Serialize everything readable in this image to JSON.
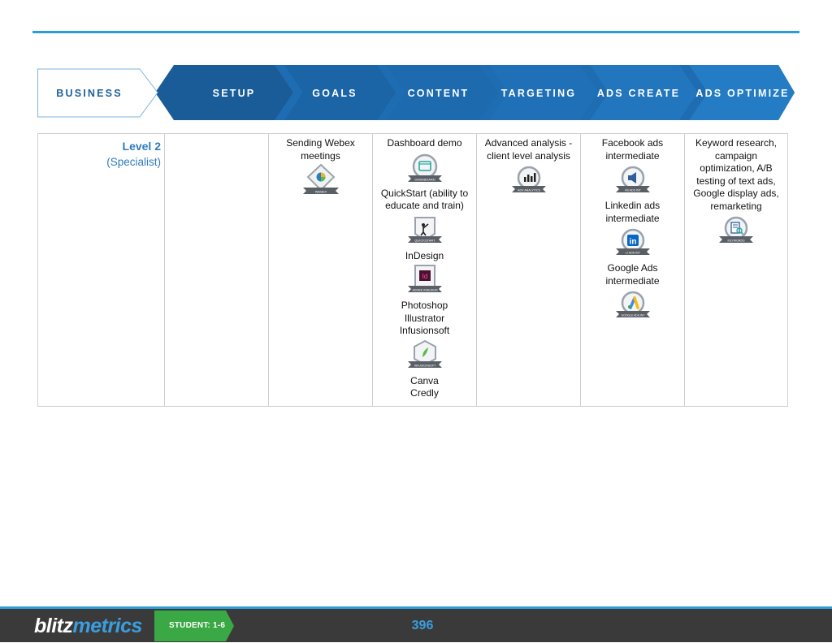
{
  "header": {
    "steps": [
      {
        "label": "BUSINESS"
      },
      {
        "label": "SETUP"
      },
      {
        "label": "GOALS"
      },
      {
        "label": "CONTENT"
      },
      {
        "label": "TARGETING"
      },
      {
        "label": "ADS CREATE"
      },
      {
        "label": "ADS OPTIMIZE"
      }
    ],
    "colors": {
      "light": "#ffffff",
      "dark": "#1a5c98",
      "mid": "#1f6fb5",
      "accent": "#2e9ad6"
    }
  },
  "grid": {
    "level_title": "Level 2",
    "level_subtitle": "(Specialist)",
    "goals": {
      "text": "Sending Webex meetings",
      "badge_icon": "webex-badge-icon",
      "badge_label": "WEBEX"
    },
    "content": {
      "items": [
        {
          "text": "Dashboard demo",
          "badge_icon": "dashboard-badge-icon",
          "badge_label": "DASHBOARD"
        },
        {
          "text": "QuickStart (ability to educate and train)",
          "badge_icon": "quickstart-badge-icon",
          "badge_label": "QUICKSTART"
        },
        {
          "text": "InDesign",
          "badge_icon": "indesign-badge-icon",
          "badge_label": "ADOBE INDESIGN"
        },
        {
          "text_lines": [
            "Photoshop",
            "Illustrator",
            "Infusionsoft"
          ],
          "badge_icon": "infusionsoft-badge-icon",
          "badge_label": "INFUSIONSOFT"
        },
        {
          "text_lines": [
            "Canva",
            "Credly"
          ]
        }
      ]
    },
    "targeting": {
      "text": "Advanced analysis - client level analysis",
      "badge_icon": "analytics-badge-icon",
      "badge_label": "ADV ANALYTICS"
    },
    "ads_create": {
      "items": [
        {
          "text": "Facebook ads intermediate",
          "badge_icon": "facebook-ads-badge-icon",
          "badge_label": "FB ADS INT"
        },
        {
          "text": "Linkedin ads intermediate",
          "badge_icon": "linkedin-badge-icon",
          "badge_label": "LI ADS INT"
        },
        {
          "text": "Google Ads intermediate",
          "badge_icon": "google-ads-badge-icon",
          "badge_label": "GOOGLE ADS INT"
        }
      ]
    },
    "ads_optimize": {
      "text": "Keyword research, campaign optimization, A/B testing of text ads, Google display ads, remarketing",
      "badge_icon": "keywords-badge-icon",
      "badge_label": "KEYWORDS"
    }
  },
  "footer": {
    "logo_part1": "blitz",
    "logo_part2": "metrics",
    "student_label": "STUDENT: 1-6",
    "page_number": "396",
    "colors": {
      "bar": "#3a3a3a",
      "tag": "#3aa845",
      "accent": "#3a9ee0"
    }
  }
}
